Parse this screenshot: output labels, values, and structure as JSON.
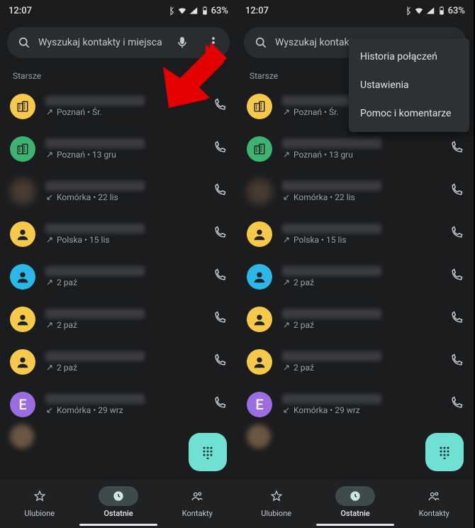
{
  "status": {
    "time": "12:07",
    "battery": "63%"
  },
  "search": {
    "placeholder": "Wyszukaj kontakty i miejsca",
    "placeholder_short": "Wyszukaj kontakty"
  },
  "section": "Starsze",
  "calls": [
    {
      "avatar": "building",
      "color": "#f7c948",
      "sub": "Poznań • Śr.",
      "dir": "out"
    },
    {
      "avatar": "building",
      "color": "#3cb371",
      "sub": "Poznań • 13 gru",
      "dir": "out"
    },
    {
      "avatar": "none",
      "color": "#4a3c32",
      "sub": "Komórka • 22 lis",
      "dir": "in"
    },
    {
      "avatar": "person",
      "color": "#f7c948",
      "sub": "Polska • 15 lis",
      "dir": "out"
    },
    {
      "avatar": "person",
      "color": "#2bb8e6",
      "sub": "2 paź",
      "dir": "out"
    },
    {
      "avatar": "person",
      "color": "#f7c948",
      "sub": "2 paź",
      "dir": "out"
    },
    {
      "avatar": "person",
      "color": "#f7c948",
      "sub": "2 paź",
      "dir": "out"
    },
    {
      "avatar": "letter",
      "letter": "E",
      "color": "#9b6de0",
      "sub": "Komórka • 29 wrz",
      "dir": "in"
    }
  ],
  "nav": {
    "fav": "Ulubione",
    "recent": "Ostatnie",
    "contacts": "Kontakty"
  },
  "menu": [
    "Historia połączeń",
    "Ustawienia",
    "Pomoc i komentarze"
  ]
}
